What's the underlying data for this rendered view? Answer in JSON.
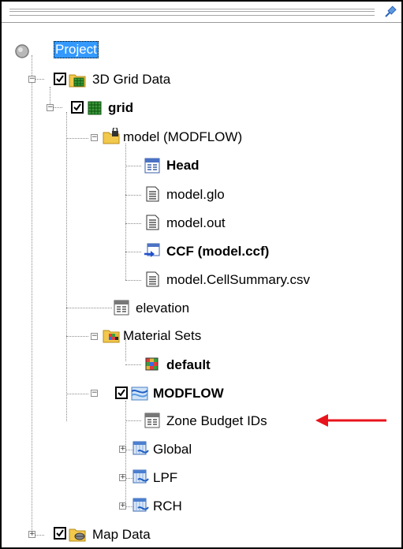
{
  "tree": {
    "project_label": "Project",
    "grid_data_label": "3D Grid Data",
    "grid_label": "grid",
    "model_label": "model (MODFLOW)",
    "head_label": "Head",
    "glo_label": "model.glo",
    "out_label": "model.out",
    "ccf_label": "CCF (model.ccf)",
    "cellsummary_label": "model.CellSummary.csv",
    "elevation_label": "elevation",
    "material_sets_label": "Material Sets",
    "default_label": "default",
    "modflow_label": "MODFLOW",
    "zone_budget_label": "Zone Budget IDs",
    "global_label": "Global",
    "lpf_label": "LPF",
    "rch_label": "RCH",
    "map_data_label": "Map Data"
  },
  "colors": {
    "selection": "#3399ff",
    "arrow": "#e8141c",
    "folder": "#f2c94c"
  },
  "annotation": {
    "arrow_target": "zone-budget-ids"
  }
}
